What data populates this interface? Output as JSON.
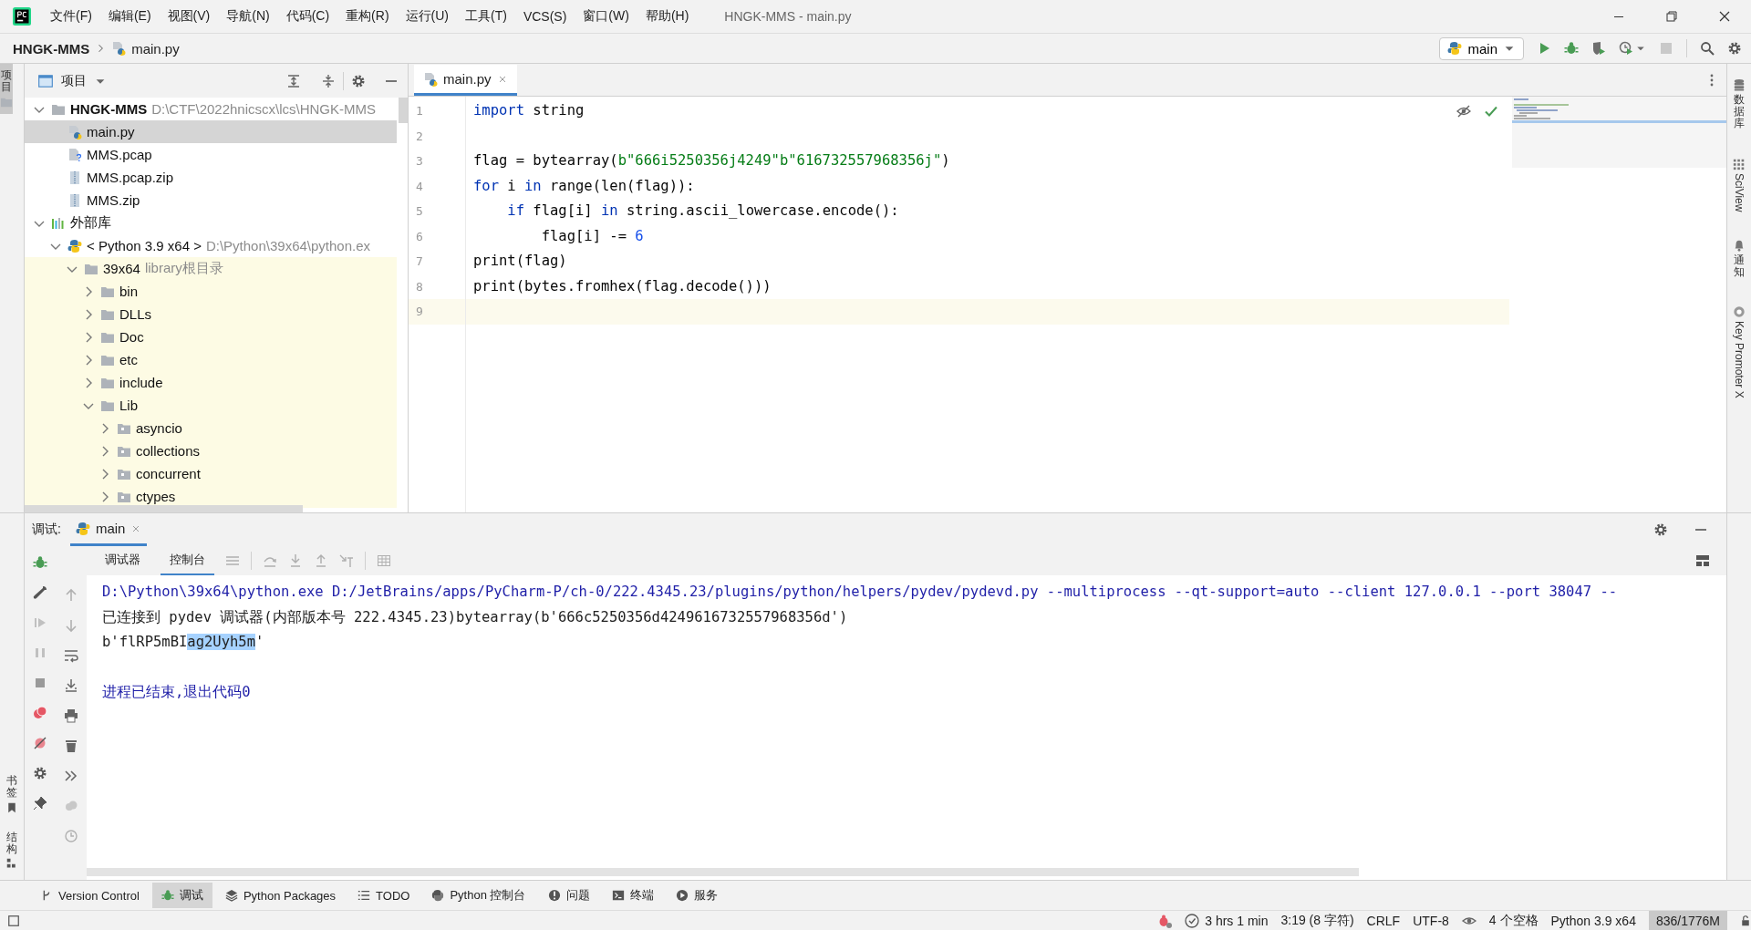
{
  "menu": [
    "文件(F)",
    "编辑(E)",
    "视图(V)",
    "导航(N)",
    "代码(C)",
    "重构(R)",
    "运行(U)",
    "工具(T)",
    "VCS(S)",
    "窗口(W)",
    "帮助(H)"
  ],
  "window_title": "HNGK-MMS - main.py",
  "breadcrumb": [
    "HNGK-MMS",
    "main.py"
  ],
  "run_config": "main",
  "left_strip": {
    "top": [
      "项目"
    ],
    "bottom": [
      "书签",
      "结构"
    ]
  },
  "right_strip": [
    "数据库",
    "SciView",
    "通知",
    "Key Promoter X"
  ],
  "project_panel": {
    "title": "项目",
    "tree": [
      {
        "label": "HNGK-MMS",
        "hint": "D:\\CTF\\2022hnicscx\\lcs\\HNGK-MMS",
        "kind": "root",
        "expanded": true,
        "selected": false,
        "children": [
          {
            "label": "main.py",
            "kind": "python",
            "selected": true
          },
          {
            "label": "MMS.pcap",
            "kind": "unknown",
            "selected": false
          },
          {
            "label": "MMS.pcap.zip",
            "kind": "zip",
            "selected": false
          },
          {
            "label": "MMS.zip",
            "kind": "zip",
            "selected": false
          }
        ]
      },
      {
        "label": "外部库",
        "kind": "libraries",
        "expanded": true,
        "selected": false,
        "children": [
          {
            "label": "< Python 3.9 x64 >",
            "hint": "D:\\Python\\39x64\\python.ex",
            "kind": "sdk",
            "expanded": true,
            "selected": false,
            "children": [
              {
                "label": "39x64",
                "hint": "library根目录",
                "kind": "libroot",
                "expanded": true,
                "selected": false,
                "children": [
                  {
                    "label": "bin",
                    "kind": "folder",
                    "expanded": false,
                    "selected": false
                  },
                  {
                    "label": "DLLs",
                    "kind": "folder",
                    "expanded": false,
                    "selected": false
                  },
                  {
                    "label": "Doc",
                    "kind": "folder",
                    "expanded": false,
                    "selected": false
                  },
                  {
                    "label": "etc",
                    "kind": "folder",
                    "expanded": false,
                    "selected": false
                  },
                  {
                    "label": "include",
                    "kind": "folder",
                    "expanded": false,
                    "selected": false
                  },
                  {
                    "label": "Lib",
                    "kind": "folder",
                    "expanded": true,
                    "selected": false,
                    "children": [
                      {
                        "label": "asyncio",
                        "kind": "package",
                        "expanded": false,
                        "selected": false
                      },
                      {
                        "label": "collections",
                        "kind": "package",
                        "expanded": false,
                        "selected": false
                      },
                      {
                        "label": "concurrent",
                        "kind": "package",
                        "expanded": false,
                        "selected": false
                      },
                      {
                        "label": "ctypes",
                        "kind": "package",
                        "expanded": false,
                        "selected": false
                      }
                    ]
                  }
                ]
              }
            ]
          }
        ]
      }
    ]
  },
  "editor": {
    "tabs": [
      {
        "label": "main.py",
        "selected": true
      }
    ],
    "lines": [
      {
        "number": "1",
        "current": false,
        "tokens": [
          {
            "t": "import",
            "kind": "kw"
          },
          {
            "t": " string",
            "kind": "plain"
          }
        ]
      },
      {
        "number": "2",
        "current": false
      },
      {
        "number": "3",
        "current": false,
        "tokens": [
          {
            "t": "flag = bytearray(",
            "kind": "plain"
          },
          {
            "t": "b\"666i5250356j4249\"",
            "kind": "str"
          },
          {
            "t": "b\"616732557968356j\"",
            "kind": "str"
          },
          {
            "t": ")",
            "kind": "plain"
          }
        ]
      },
      {
        "number": "4",
        "current": false,
        "tokens": [
          {
            "t": "for",
            "kind": "kw"
          },
          {
            "t": " i ",
            "kind": "plain"
          },
          {
            "t": "in",
            "kind": "kw"
          },
          {
            "t": " range(len(flag)):",
            "kind": "plain"
          }
        ]
      },
      {
        "number": "5",
        "current": false,
        "tokens": [
          {
            "t": "    if",
            "kind": "kw"
          },
          {
            "t": " flag[i] ",
            "kind": "plain"
          },
          {
            "t": "in",
            "kind": "kw"
          },
          {
            "t": " string.ascii_lowercase.encode():",
            "kind": "plain"
          }
        ]
      },
      {
        "number": "6",
        "current": false,
        "tokens": [
          {
            "t": "        flag[i] -= ",
            "kind": "plain"
          },
          {
            "t": "6",
            "kind": "num"
          }
        ]
      },
      {
        "number": "7",
        "current": false,
        "tokens": [
          {
            "t": "print(flag)",
            "kind": "plain"
          }
        ]
      },
      {
        "number": "8",
        "current": false,
        "tokens": [
          {
            "t": "print(bytes.fromhex(flag.decode()))",
            "kind": "plain"
          }
        ]
      },
      {
        "number": "9",
        "current": true
      }
    ]
  },
  "debug": {
    "label": "调试:",
    "tabs": [
      {
        "label": "main",
        "selected": true
      }
    ],
    "subtabs": [
      {
        "label": "调试器",
        "selected": false
      },
      {
        "label": "控制台",
        "selected": true
      }
    ],
    "console": [
      {
        "kind": "system",
        "segments": [
          {
            "text": "D:\\Python\\39x64\\python.exe D:/JetBrains/apps/PyCharm-P/ch-0/222.4345.23/plugins/python/helpers/pydev/pydevd.py --multiprocess --qt-support=auto --client 127.0.0.1 --port 38047 --",
            "selected": false
          }
        ]
      },
      {
        "kind": "output",
        "segments": [
          {
            "text": "已连接到 pydev 调试器(内部版本号 222.4345.23)bytearray(b'666c5250356d4249616732557968356d')",
            "selected": false
          }
        ]
      },
      {
        "kind": "output",
        "segments": [
          {
            "text": "b'flRP5mBI",
            "selected": false
          },
          {
            "text": "ag2Uyh5m",
            "selected": true
          },
          {
            "text": "'",
            "selected": false
          }
        ]
      },
      {
        "kind": "blank"
      },
      {
        "kind": "system",
        "segments": [
          {
            "text": "进程已结束,退出代码0",
            "selected": false
          }
        ]
      }
    ]
  },
  "tool_windows": [
    {
      "label": "Version Control",
      "kind": "vcs",
      "selected": false
    },
    {
      "label": "调试",
      "kind": "debug",
      "selected": true
    },
    {
      "label": "Python Packages",
      "kind": "packages",
      "selected": false
    },
    {
      "label": "TODO",
      "kind": "todo",
      "selected": false
    },
    {
      "label": "Python 控制台",
      "kind": "console",
      "selected": false
    },
    {
      "label": "问题",
      "kind": "problems",
      "selected": false
    },
    {
      "label": "终端",
      "kind": "terminal",
      "selected": false
    },
    {
      "label": "服务",
      "kind": "services",
      "selected": false
    }
  ],
  "status": [
    {
      "text": "3 hrs 1 min",
      "kind": "timer"
    },
    {
      "text": "3:19 (8 字符)",
      "kind": "text"
    },
    {
      "text": "CRLF",
      "kind": "text"
    },
    {
      "text": "UTF-8",
      "kind": "text"
    },
    {
      "text": "4 个空格",
      "kind": "eye"
    },
    {
      "text": "Python 3.9 x64",
      "kind": "text"
    },
    {
      "text": "836/1776M",
      "kind": "memory"
    }
  ]
}
